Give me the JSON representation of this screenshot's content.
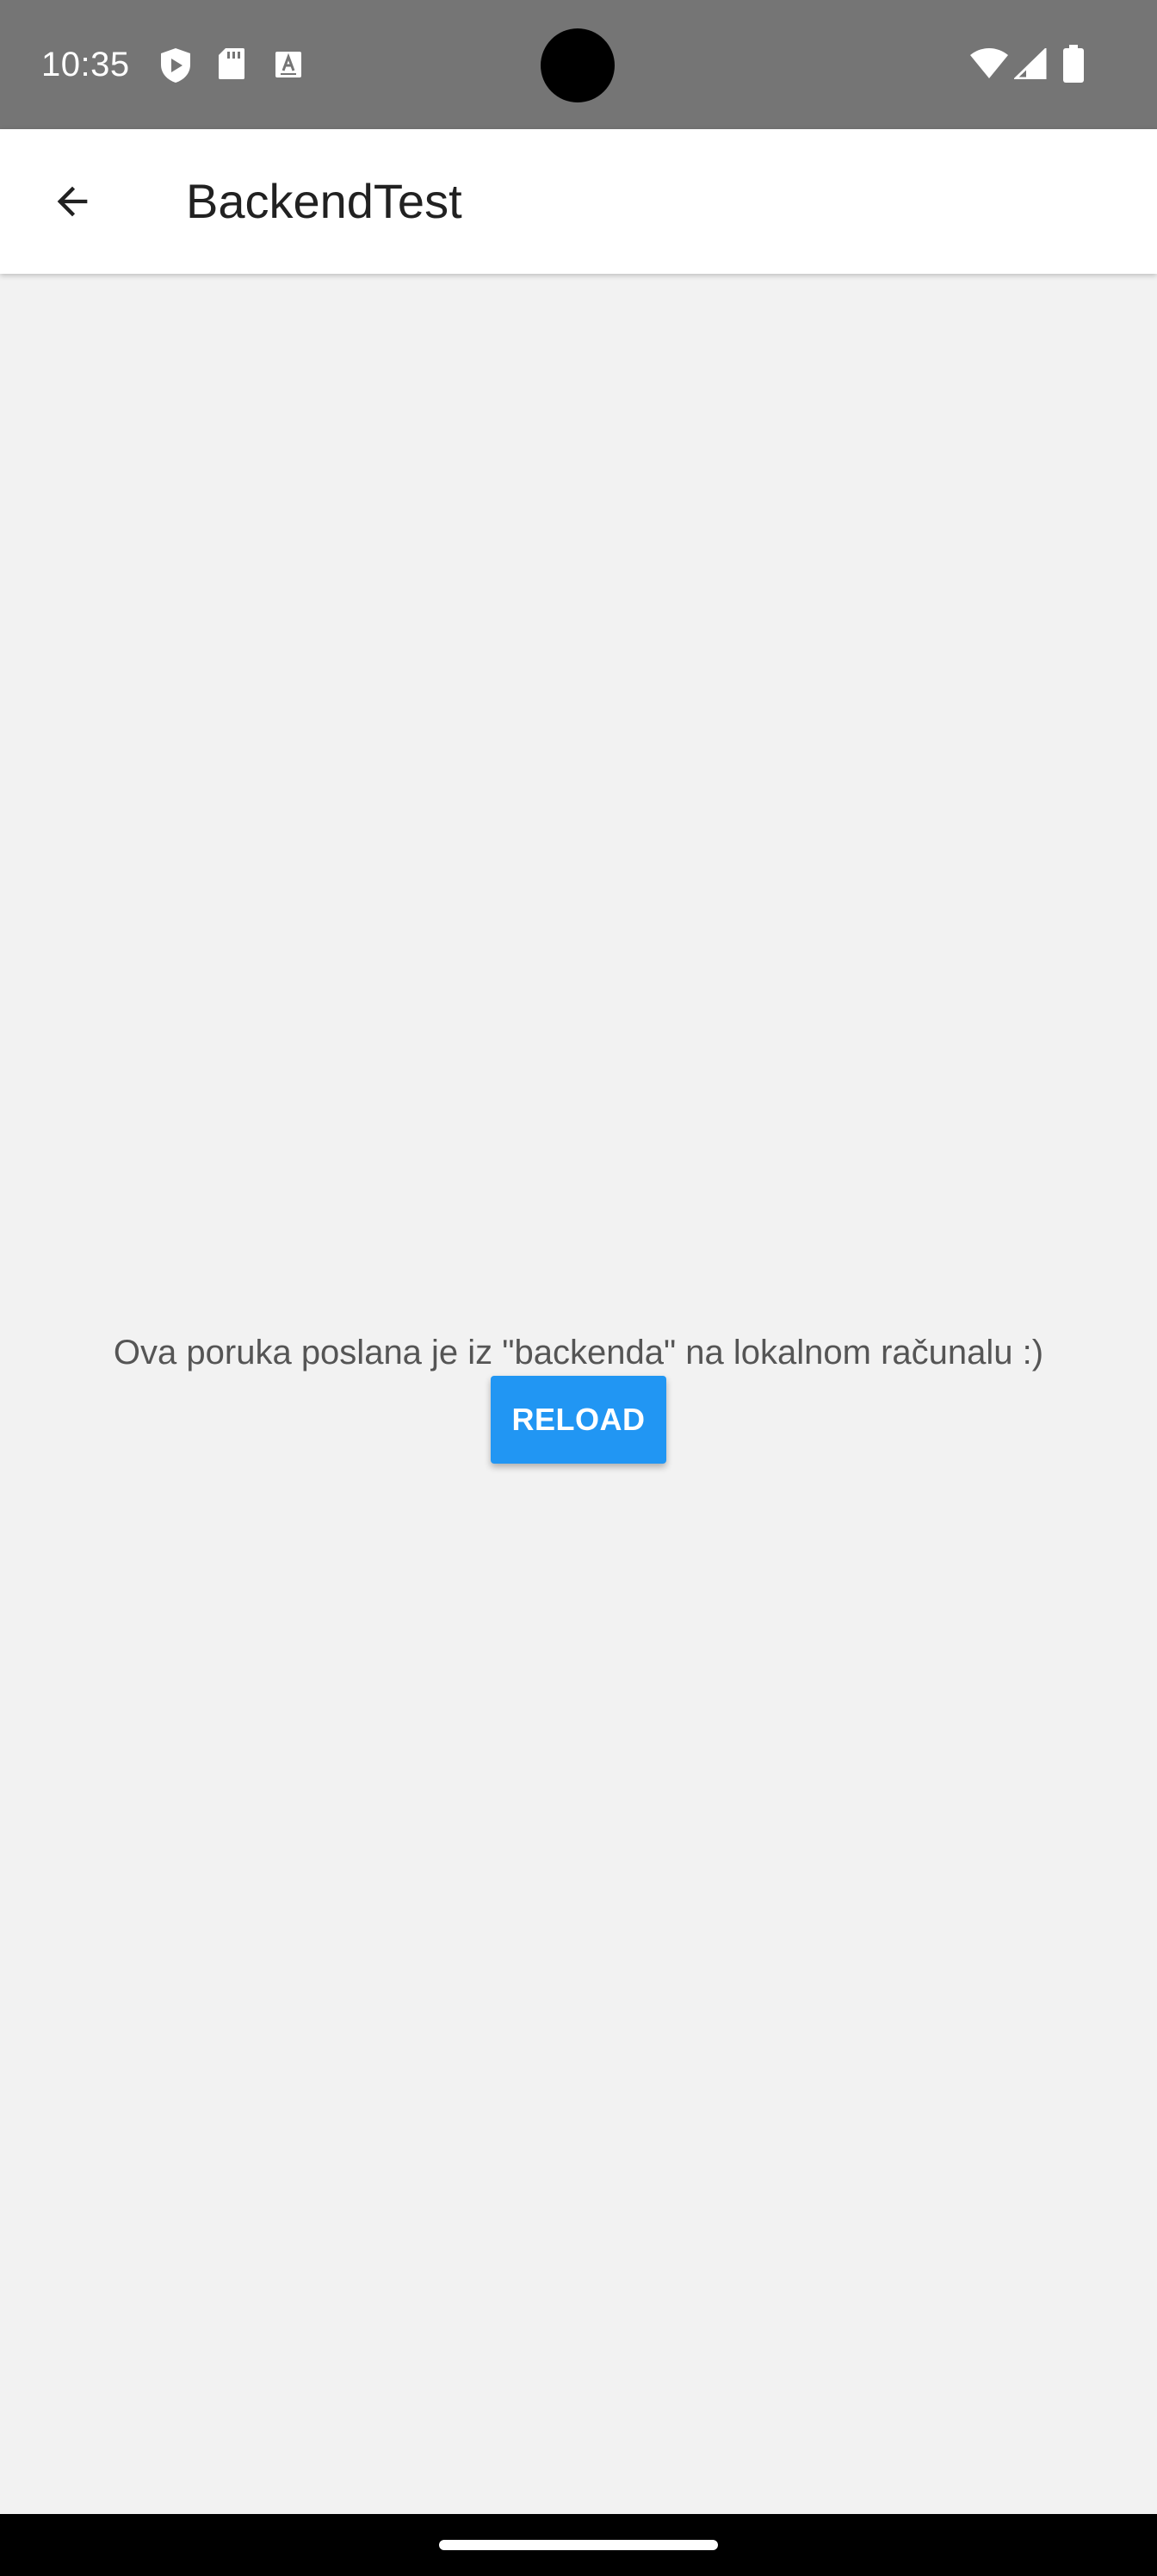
{
  "status_bar": {
    "time": "10:35",
    "left_icons": [
      "shield-icon",
      "sd-card-icon",
      "keyboard-a-icon"
    ],
    "right_icons": [
      "wifi-icon",
      "cell-signal-icon",
      "battery-icon"
    ],
    "background": "#757575"
  },
  "app_bar": {
    "title": "BackendTest",
    "back_icon": "arrow-back-icon"
  },
  "main": {
    "message": "Ova poruka poslana je iz \"backenda\" na lokalnom računalu :)",
    "reload_label": "RELOAD",
    "accent_color": "#2196f3"
  },
  "nav_bar": {
    "handle": "gesture-handle"
  }
}
